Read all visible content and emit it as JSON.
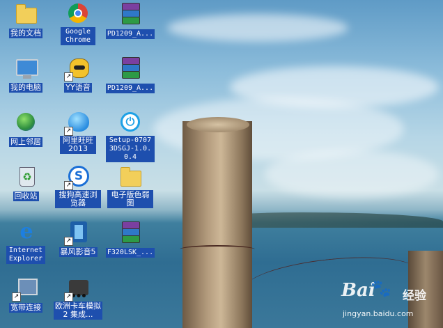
{
  "desktop": {
    "icons": [
      {
        "label": "我的文档",
        "icon": "folder-icon"
      },
      {
        "label": "Google Chrome",
        "icon": "chrome-icon"
      },
      {
        "label": "PD1209_A...",
        "icon": "winrar-icon"
      },
      {
        "label": "我的电脑",
        "icon": "computer-icon"
      },
      {
        "label": "YY语音",
        "icon": "yy-icon"
      },
      {
        "label": "PD1209_A...",
        "icon": "winrar-icon"
      },
      {
        "label": "网上邻居",
        "icon": "network-icon"
      },
      {
        "label": "阿里旺旺2013",
        "icon": "aliwangwang-icon"
      },
      {
        "label": "Setup-07073DSGJ-1.0.0.4",
        "icon": "power-icon"
      },
      {
        "label": "回收站",
        "icon": "recycle-bin-icon"
      },
      {
        "label": "搜狗高速浏览器",
        "icon": "sogou-icon"
      },
      {
        "label": "电子版色弱图",
        "icon": "folder-icon"
      },
      {
        "label": "Internet Explorer",
        "icon": "ie-icon"
      },
      {
        "label": "暴风影音5",
        "icon": "baofeng-icon"
      },
      {
        "label": "F320LSK_...",
        "icon": "winrar-icon"
      },
      {
        "label": "宽带连接",
        "icon": "broadband-icon"
      },
      {
        "label": "欧洲卡车模拟2 集成...",
        "icon": "truck-icon"
      }
    ]
  },
  "watermark": {
    "brand": "Bai",
    "brand_cn": "经验",
    "url": "jingyan.baidu.com"
  }
}
